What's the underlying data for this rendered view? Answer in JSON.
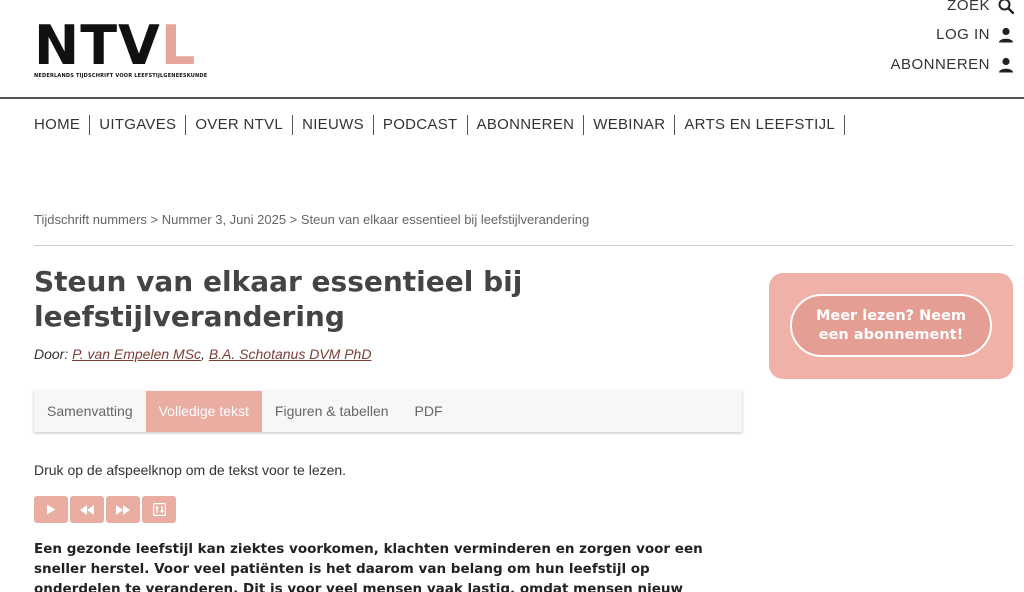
{
  "logo": {
    "letters_dark": "NTV",
    "letters_pink": "L",
    "tagline": "NEDERLANDS TIJDSCHRIFT VOOR LEEFSTIJLGENEESKUNDE"
  },
  "utility": {
    "search_label": "ZOEK",
    "login_label": "LOG IN",
    "subscribe_label": "ABONNEREN"
  },
  "nav": {
    "items": [
      "HOME",
      "UITGAVES",
      "OVER NTVL",
      "NIEUWS",
      "PODCAST",
      "ABONNEREN",
      "WEBINAR",
      "ARTS EN LEEFSTIJL"
    ]
  },
  "breadcrumb": {
    "crumb1": "Tijdschrift nummers",
    "sep": " > ",
    "crumb2": "Nummer 3, Juni 2025",
    "crumb3": "Steun van elkaar essentieel bij leefstijlverandering"
  },
  "article": {
    "title": "Steun van elkaar essentieel bij leefstijlverandering",
    "by_label": "Door: ",
    "author1": "P. van Empelen MSc",
    "author_sep": ", ",
    "author2": "B.A. Schotanus DVM PhD",
    "tabs": [
      "Samenvatting",
      "Volledige tekst",
      "Figuren & tabellen",
      "PDF"
    ],
    "active_tab": "Volledige tekst",
    "instruction": "Druk op de afspeelknop om de tekst voor te lezen.",
    "lead": "Een gezonde leefstijl kan ziektes voorkomen, klachten verminderen en zorgen voor een sneller herstel. Voor veel patiënten is het daarom van belang om hun leefstijl op onderdelen te veranderen. Dit is voor veel mensen vaak lastig, omdat mensen nieuw gedrag moeten aanleren"
  },
  "sidebar": {
    "cta_label": "Meer lezen? Neem een abonnement!"
  },
  "colors": {
    "accent": "#eaada2",
    "accent_dark": "#e59e93",
    "author_link": "#7a3f36"
  },
  "icons": [
    "search-icon",
    "user-icon",
    "play-icon",
    "rewind-icon",
    "fast-forward-icon",
    "settings-icon"
  ]
}
